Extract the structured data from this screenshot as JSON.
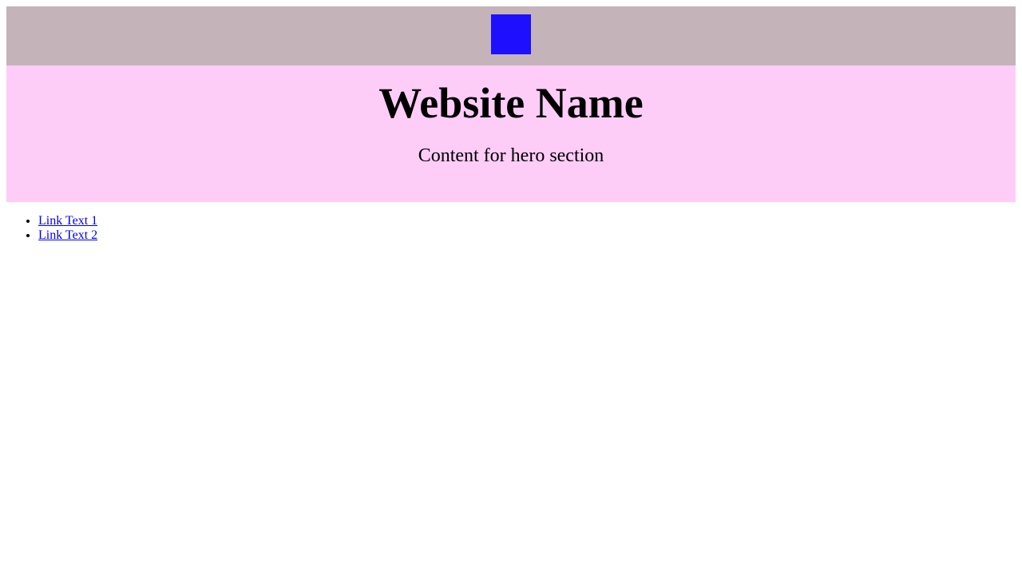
{
  "colors": {
    "top_bar_bg": "#c4b4ba",
    "logo": "#1e0fff",
    "hero_bg": "#fdcdf8",
    "link": "#0000ee"
  },
  "header": {
    "logo_icon": "blue-square-logo"
  },
  "hero": {
    "title": "Website Name",
    "content": "Content for hero section"
  },
  "nav": {
    "links": [
      {
        "label": "Link Text 1"
      },
      {
        "label": "Link Text 2"
      }
    ]
  }
}
